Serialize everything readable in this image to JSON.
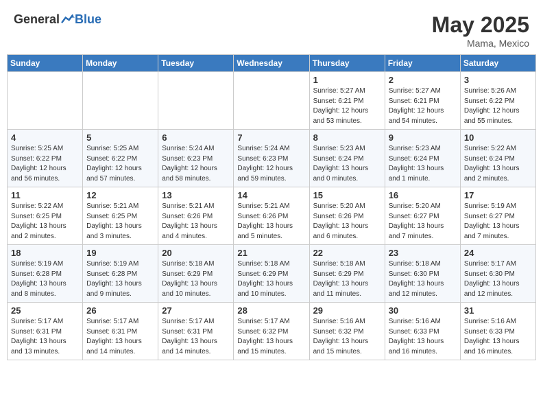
{
  "header": {
    "logo_general": "General",
    "logo_blue": "Blue",
    "month_year": "May 2025",
    "location": "Mama, Mexico"
  },
  "days_of_week": [
    "Sunday",
    "Monday",
    "Tuesday",
    "Wednesday",
    "Thursday",
    "Friday",
    "Saturday"
  ],
  "weeks": [
    [
      {
        "day": "",
        "info": ""
      },
      {
        "day": "",
        "info": ""
      },
      {
        "day": "",
        "info": ""
      },
      {
        "day": "",
        "info": ""
      },
      {
        "day": "1",
        "info": "Sunrise: 5:27 AM\nSunset: 6:21 PM\nDaylight: 12 hours\nand 53 minutes."
      },
      {
        "day": "2",
        "info": "Sunrise: 5:27 AM\nSunset: 6:21 PM\nDaylight: 12 hours\nand 54 minutes."
      },
      {
        "day": "3",
        "info": "Sunrise: 5:26 AM\nSunset: 6:22 PM\nDaylight: 12 hours\nand 55 minutes."
      }
    ],
    [
      {
        "day": "4",
        "info": "Sunrise: 5:25 AM\nSunset: 6:22 PM\nDaylight: 12 hours\nand 56 minutes."
      },
      {
        "day": "5",
        "info": "Sunrise: 5:25 AM\nSunset: 6:22 PM\nDaylight: 12 hours\nand 57 minutes."
      },
      {
        "day": "6",
        "info": "Sunrise: 5:24 AM\nSunset: 6:23 PM\nDaylight: 12 hours\nand 58 minutes."
      },
      {
        "day": "7",
        "info": "Sunrise: 5:24 AM\nSunset: 6:23 PM\nDaylight: 12 hours\nand 59 minutes."
      },
      {
        "day": "8",
        "info": "Sunrise: 5:23 AM\nSunset: 6:24 PM\nDaylight: 13 hours\nand 0 minutes."
      },
      {
        "day": "9",
        "info": "Sunrise: 5:23 AM\nSunset: 6:24 PM\nDaylight: 13 hours\nand 1 minute."
      },
      {
        "day": "10",
        "info": "Sunrise: 5:22 AM\nSunset: 6:24 PM\nDaylight: 13 hours\nand 2 minutes."
      }
    ],
    [
      {
        "day": "11",
        "info": "Sunrise: 5:22 AM\nSunset: 6:25 PM\nDaylight: 13 hours\nand 2 minutes."
      },
      {
        "day": "12",
        "info": "Sunrise: 5:21 AM\nSunset: 6:25 PM\nDaylight: 13 hours\nand 3 minutes."
      },
      {
        "day": "13",
        "info": "Sunrise: 5:21 AM\nSunset: 6:26 PM\nDaylight: 13 hours\nand 4 minutes."
      },
      {
        "day": "14",
        "info": "Sunrise: 5:21 AM\nSunset: 6:26 PM\nDaylight: 13 hours\nand 5 minutes."
      },
      {
        "day": "15",
        "info": "Sunrise: 5:20 AM\nSunset: 6:26 PM\nDaylight: 13 hours\nand 6 minutes."
      },
      {
        "day": "16",
        "info": "Sunrise: 5:20 AM\nSunset: 6:27 PM\nDaylight: 13 hours\nand 7 minutes."
      },
      {
        "day": "17",
        "info": "Sunrise: 5:19 AM\nSunset: 6:27 PM\nDaylight: 13 hours\nand 7 minutes."
      }
    ],
    [
      {
        "day": "18",
        "info": "Sunrise: 5:19 AM\nSunset: 6:28 PM\nDaylight: 13 hours\nand 8 minutes."
      },
      {
        "day": "19",
        "info": "Sunrise: 5:19 AM\nSunset: 6:28 PM\nDaylight: 13 hours\nand 9 minutes."
      },
      {
        "day": "20",
        "info": "Sunrise: 5:18 AM\nSunset: 6:29 PM\nDaylight: 13 hours\nand 10 minutes."
      },
      {
        "day": "21",
        "info": "Sunrise: 5:18 AM\nSunset: 6:29 PM\nDaylight: 13 hours\nand 10 minutes."
      },
      {
        "day": "22",
        "info": "Sunrise: 5:18 AM\nSunset: 6:29 PM\nDaylight: 13 hours\nand 11 minutes."
      },
      {
        "day": "23",
        "info": "Sunrise: 5:18 AM\nSunset: 6:30 PM\nDaylight: 13 hours\nand 12 minutes."
      },
      {
        "day": "24",
        "info": "Sunrise: 5:17 AM\nSunset: 6:30 PM\nDaylight: 13 hours\nand 12 minutes."
      }
    ],
    [
      {
        "day": "25",
        "info": "Sunrise: 5:17 AM\nSunset: 6:31 PM\nDaylight: 13 hours\nand 13 minutes."
      },
      {
        "day": "26",
        "info": "Sunrise: 5:17 AM\nSunset: 6:31 PM\nDaylight: 13 hours\nand 14 minutes."
      },
      {
        "day": "27",
        "info": "Sunrise: 5:17 AM\nSunset: 6:31 PM\nDaylight: 13 hours\nand 14 minutes."
      },
      {
        "day": "28",
        "info": "Sunrise: 5:17 AM\nSunset: 6:32 PM\nDaylight: 13 hours\nand 15 minutes."
      },
      {
        "day": "29",
        "info": "Sunrise: 5:16 AM\nSunset: 6:32 PM\nDaylight: 13 hours\nand 15 minutes."
      },
      {
        "day": "30",
        "info": "Sunrise: 5:16 AM\nSunset: 6:33 PM\nDaylight: 13 hours\nand 16 minutes."
      },
      {
        "day": "31",
        "info": "Sunrise: 5:16 AM\nSunset: 6:33 PM\nDaylight: 13 hours\nand 16 minutes."
      }
    ]
  ]
}
